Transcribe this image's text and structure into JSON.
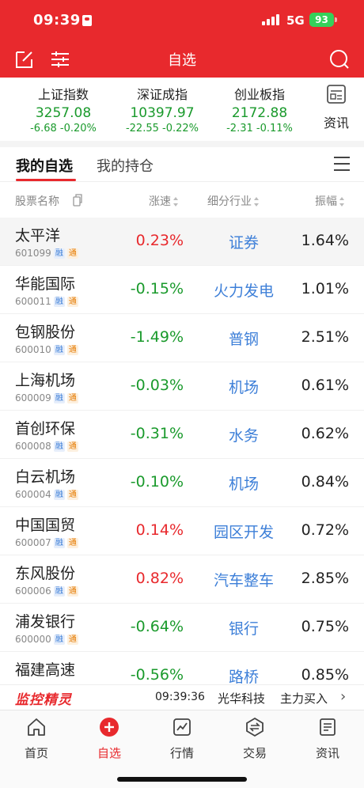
{
  "status_bar": {
    "time": "09:39",
    "network": "5G",
    "battery": "93"
  },
  "nav": {
    "title": "自选"
  },
  "indices": [
    {
      "name": "上证指数",
      "value": "3257.08",
      "change": "-6.68",
      "pct": "-0.20%"
    },
    {
      "name": "深证成指",
      "value": "10397.97",
      "change": "-22.55",
      "pct": "-0.22%"
    },
    {
      "name": "创业板指",
      "value": "2172.88",
      "change": "-2.31",
      "pct": "-0.11%"
    }
  ],
  "news_button": {
    "label": "资讯"
  },
  "tabs": [
    {
      "label": "我的自选"
    },
    {
      "label": "我的持仓"
    }
  ],
  "columns": {
    "name": "股票名称",
    "change": "涨速",
    "industry": "细分行业",
    "amplitude": "振幅"
  },
  "tags": {
    "margin": "融",
    "connect": "通"
  },
  "rows": [
    {
      "name": "太平洋",
      "code": "601099",
      "change": "0.23%",
      "industry": "证券",
      "amplitude": "1.64%"
    },
    {
      "name": "华能国际",
      "code": "600011",
      "change": "-0.15%",
      "industry": "火力发电",
      "amplitude": "1.01%"
    },
    {
      "name": "包钢股份",
      "code": "600010",
      "change": "-1.49%",
      "industry": "普钢",
      "amplitude": "2.51%"
    },
    {
      "name": "上海机场",
      "code": "600009",
      "change": "-0.03%",
      "industry": "机场",
      "amplitude": "0.61%"
    },
    {
      "name": "首创环保",
      "code": "600008",
      "change": "-0.31%",
      "industry": "水务",
      "amplitude": "0.62%"
    },
    {
      "name": "白云机场",
      "code": "600004",
      "change": "-0.10%",
      "industry": "机场",
      "amplitude": "0.84%"
    },
    {
      "name": "中国国贸",
      "code": "600007",
      "change": "0.14%",
      "industry": "园区开发",
      "amplitude": "0.72%"
    },
    {
      "name": "东风股份",
      "code": "600006",
      "change": "0.82%",
      "industry": "汽车整车",
      "amplitude": "2.85%"
    },
    {
      "name": "浦发银行",
      "code": "600000",
      "change": "-0.64%",
      "industry": "银行",
      "amplitude": "0.75%"
    },
    {
      "name": "福建高速",
      "code": "",
      "change": "-0.56%",
      "industry": "路桥",
      "amplitude": "0.85%"
    }
  ],
  "ticker": {
    "brand": "监控精灵",
    "time": "09:39:36",
    "stock": "光华科技",
    "action": "主力买入",
    "arrow": "›"
  },
  "bottom_tabs": [
    {
      "label": "首页",
      "icon": "home-icon"
    },
    {
      "label": "自选",
      "icon": "plus-circle-icon"
    },
    {
      "label": "行情",
      "icon": "chart-icon"
    },
    {
      "label": "交易",
      "icon": "exchange-icon"
    },
    {
      "label": "资讯",
      "icon": "news-icon"
    }
  ],
  "colors": {
    "brand_red": "#e8292d",
    "up": "#e8292d",
    "down": "#1a9a2c",
    "industry_blue": "#3d7fd8"
  }
}
